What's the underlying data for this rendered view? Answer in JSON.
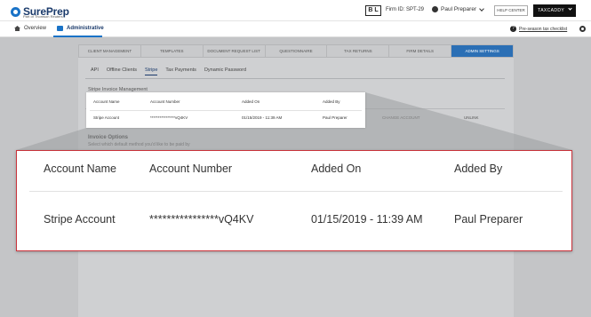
{
  "header": {
    "logo_text": "SurePrep",
    "logo_sub": "Part of Thomson Reuters",
    "bl_badge": "B L",
    "firm_id": "Firm ID: SPT-29",
    "user_name": "Paul Preparer",
    "help_center": "HELP CENTER",
    "taxcaddy": "TAXCADDY"
  },
  "subnav": {
    "overview": "Overview",
    "administrative": "Administrative",
    "checklist": "Pre-season tax checklist"
  },
  "admin_tabs": [
    {
      "label": "CLIENT MANAGEMENT"
    },
    {
      "label": "TEMPLATES"
    },
    {
      "label": "DOCUMENT REQUEST LIST"
    },
    {
      "label": "QUESTIONNAIRE"
    },
    {
      "label": "TAX RETURNS"
    },
    {
      "label": "FIRM DETAILS"
    },
    {
      "label": "ADMIN SETTINGS"
    }
  ],
  "sub_tabs": [
    {
      "label": "API"
    },
    {
      "label": "Offline Clients"
    },
    {
      "label": "Stripe"
    },
    {
      "label": "Tax Payments"
    },
    {
      "label": "Dynamic Password"
    }
  ],
  "stripe": {
    "section_title": "Stripe Invoice Management",
    "change_account": "CHANGE ACCOUNT",
    "unlink": "UNLINK",
    "invoice_options_title": "Invoice Options",
    "invoice_options_sub": "Select which default method you'd like to be paid by"
  },
  "table": {
    "headers": {
      "account_name": "Account Name",
      "account_number": "Account Number",
      "added_on": "Added On",
      "added_by": "Added By"
    },
    "row": {
      "account_name": "Stripe Account",
      "account_number": "****************vQ4KV",
      "added_on": "01/15/2019 - 11:39 AM",
      "added_by": "Paul Preparer"
    }
  },
  "colors": {
    "accent": "#2b6fb5",
    "callout_border": "#c9323a",
    "brand_dark": "#1a3a6b"
  }
}
